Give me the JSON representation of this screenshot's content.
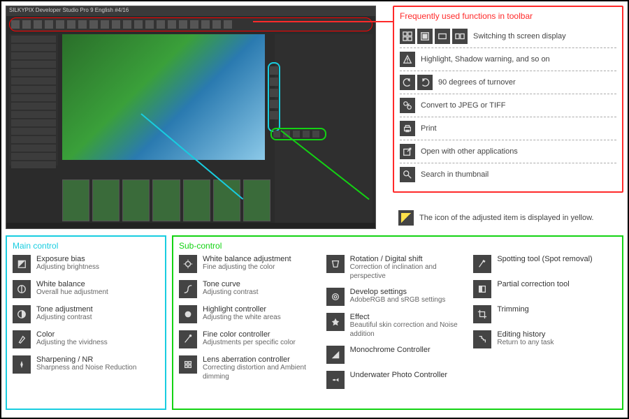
{
  "app": {
    "title": "SILKYPIX Developer Studio Pro 9 English   #4/16"
  },
  "toolbar_panel": {
    "title": "Frequently used functions in toolbar",
    "rows": [
      {
        "label": "Switching th screen display"
      },
      {
        "label": "Highlight, Shadow warning, and so on"
      },
      {
        "label": "90 degrees of turnover"
      },
      {
        "label": "Convert to JPEG or TIFF"
      },
      {
        "label": "Print"
      },
      {
        "label": "Open with other applications"
      },
      {
        "label": "Search in thumbnail"
      }
    ]
  },
  "yellow_note": "The icon of the adjusted item is displayed in yellow.",
  "main_control": {
    "title": "Main control",
    "items": [
      {
        "t1": "Exposure bias",
        "t2": "Adjusting brightness"
      },
      {
        "t1": "White balance",
        "t2": "Overall hue adjustment"
      },
      {
        "t1": "Tone adjustment",
        "t2": "Adjusting contrast"
      },
      {
        "t1": "Color",
        "t2": "Adjusting the vividness"
      },
      {
        "t1": "Sharpening / NR",
        "t2": "Sharpness and Noise Reduction"
      }
    ]
  },
  "sub_control": {
    "title": "Sub-control",
    "col1": [
      {
        "t1": "White balance adjustment",
        "t2": "Fine adjusting the color"
      },
      {
        "t1": "Tone curve",
        "t2": "Adjusting contrast"
      },
      {
        "t1": "Highlight controller",
        "t2": "Adjusting the white areas"
      },
      {
        "t1": "Fine color controller",
        "t2": "Adjustments per specific color"
      },
      {
        "t1": "Lens aberration controller",
        "t2": "Correcting distortion and Ambient dimming"
      }
    ],
    "col2": [
      {
        "t1": "Rotation / Digital shift",
        "t2": "Correction of inclination and perspective"
      },
      {
        "t1": "Develop settings",
        "t2": "AdobeRGB and sRGB settings"
      },
      {
        "t1": "Effect",
        "t2": "Beautiful skin correction and Noise addition"
      },
      {
        "t1": "Monochrome Controller",
        "t2": ""
      },
      {
        "t1": "Underwater Photo Controller",
        "t2": ""
      }
    ],
    "col3": [
      {
        "t1": "Spotting tool (Spot removal)",
        "t2": ""
      },
      {
        "t1": "Partial correction tool",
        "t2": ""
      },
      {
        "t1": "Trimming",
        "t2": ""
      },
      {
        "t1": "Editing history",
        "t2": "Return to any task"
      }
    ]
  }
}
